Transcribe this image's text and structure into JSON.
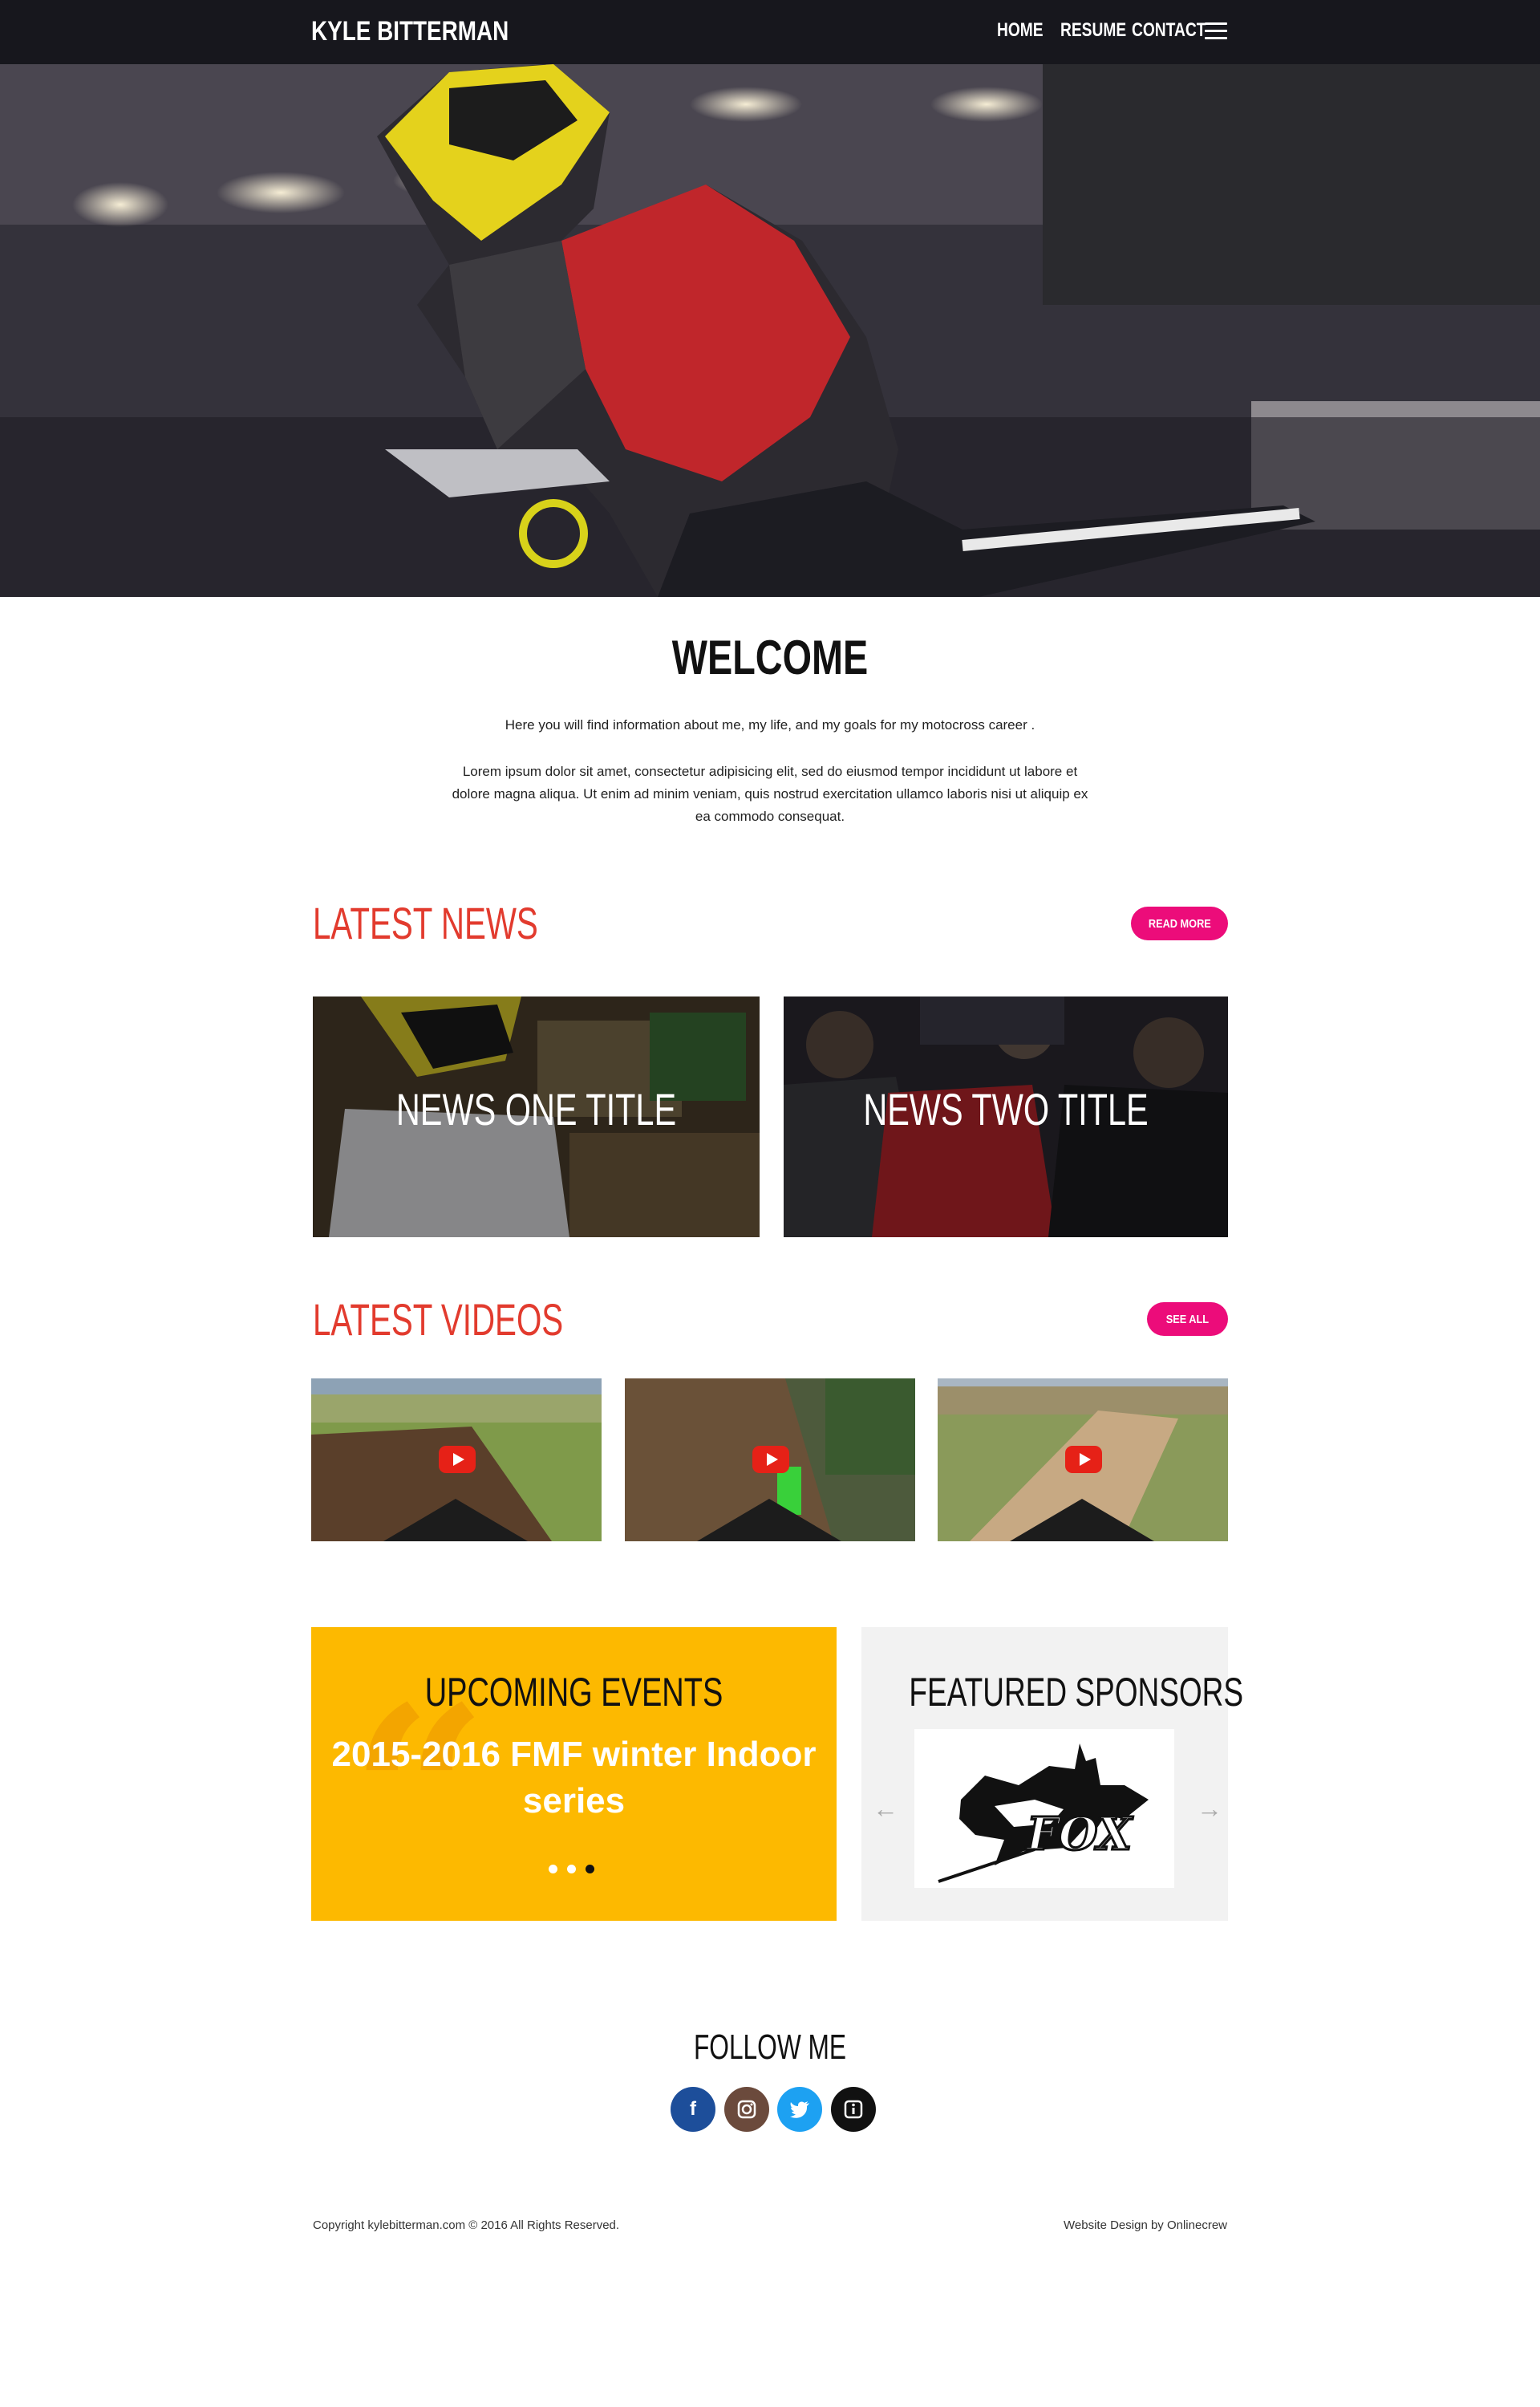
{
  "header": {
    "brand": "KYLE BITTERMAN",
    "nav": {
      "home": "HOME",
      "resume": "RESUME",
      "contact": "CONTACT"
    }
  },
  "welcome": {
    "title": "WELCOME",
    "intro": "Here you will find information about me, my life, and my goals for my motocross career .",
    "body": "Lorem ipsum dolor sit amet, consectetur adipisicing elit, sed do eiusmod tempor incididunt ut labore et dolore magna aliqua. Ut enim ad minim veniam, quis nostrud exercitation ullamco laboris nisi ut aliquip ex ea commodo consequat."
  },
  "news": {
    "title": "LATEST NEWS",
    "button": "READ MORE",
    "items": [
      {
        "title": "NEWS ONE TITLE"
      },
      {
        "title": "NEWS TWO TITLE"
      }
    ]
  },
  "videos": {
    "title": "LATEST VIDEOS",
    "button": "SEE ALL",
    "count": 3
  },
  "events": {
    "title": "UPCOMING EVENTS",
    "text": "2015-2016 FMF winter Indoor series",
    "active_slide": 3,
    "slides": 3
  },
  "sponsors": {
    "title": "FEATURED SPONSORS",
    "logo": "FOX"
  },
  "follow": {
    "title": "FOLLOW ME",
    "icons": [
      "facebook-icon",
      "instagram-icon",
      "twitter-icon",
      "info-icon"
    ]
  },
  "footer": {
    "copyright": "Copyright kylebitterman.com © 2016 All Rights Reserved.",
    "credit": "Website Design by Onlinecrew"
  },
  "colors": {
    "accent_red": "#e23b2e",
    "pill_pink": "#ec0c7a",
    "events_yellow": "#fdb900",
    "facebook": "#1d4e9a",
    "instagram": "#6b4a3c",
    "twitter": "#1da1f2",
    "info": "#111111"
  }
}
